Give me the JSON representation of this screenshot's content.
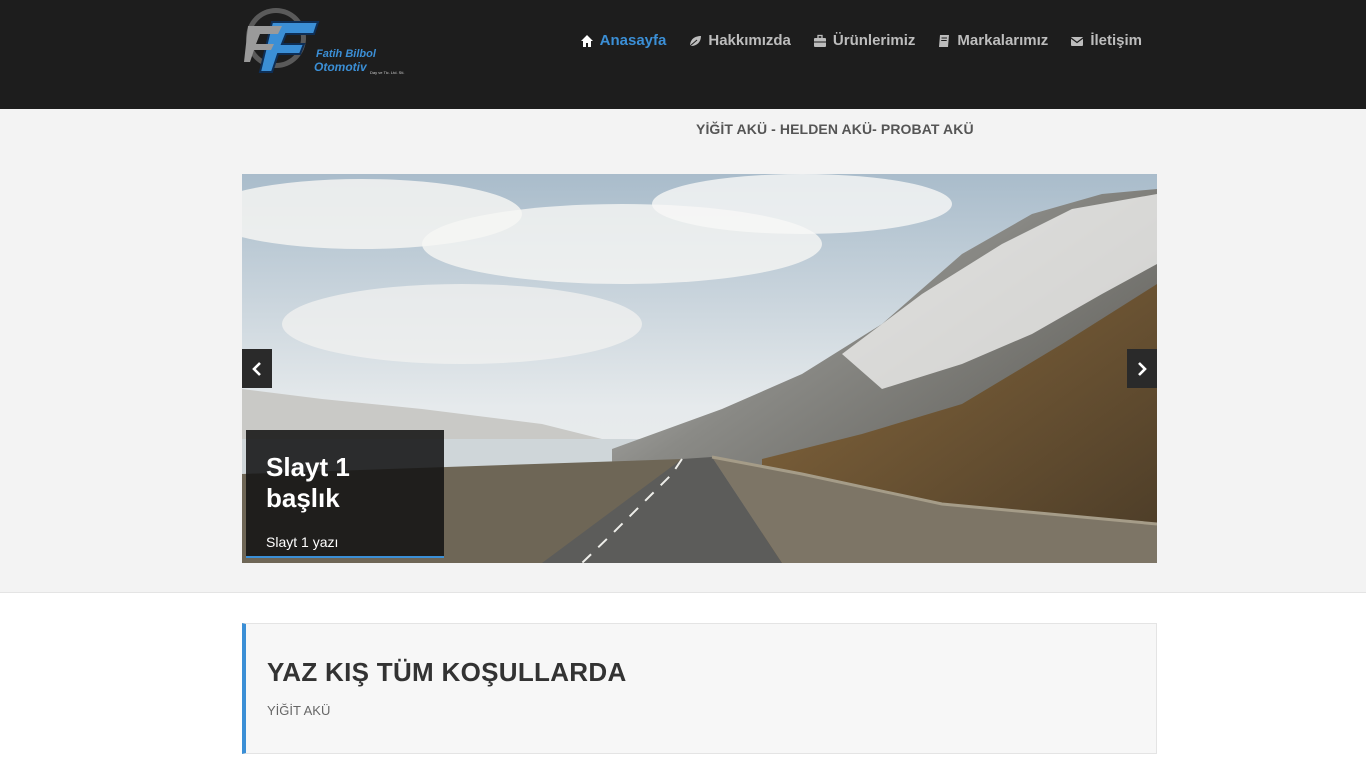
{
  "logo": {
    "line1": "Fatih Bilbol",
    "line2": "Otomotiv",
    "line3": "Day ve Tic. Ltd. Sti."
  },
  "nav": {
    "items": [
      {
        "label": "Anasayfa",
        "icon": "home-icon"
      },
      {
        "label": "Hakkımızda",
        "icon": "leaf-icon"
      },
      {
        "label": "Ürünlerimiz",
        "icon": "briefcase-icon"
      },
      {
        "label": "Markalarımız",
        "icon": "book-icon"
      },
      {
        "label": "İletişim",
        "icon": "envelope-icon"
      }
    ],
    "active_color": "#3b8fd6",
    "text_color": "#bdbdbd"
  },
  "tagline": "YİĞİT AKÜ - HELDEN AKÜ- PROBAT AKÜ",
  "slider": {
    "caption_title": "Slayt 1 başlık",
    "caption_text": "Slayt 1 yazı"
  },
  "feature": {
    "title": "YAZ KIŞ TÜM KOŞULLARDA",
    "subtitle": "YİĞİT AKÜ"
  }
}
